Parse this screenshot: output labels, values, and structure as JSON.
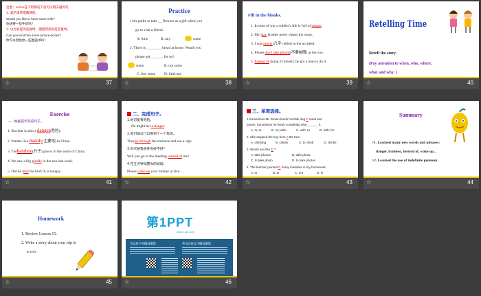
{
  "slides": [
    {
      "num": "37",
      "lines": [
        "注意：some在下列情况下也可以用于疑问句",
        "1. 表示请求或邀请时。",
        "Would you like to have some milk?",
        "你想要一些牛奶吗？",
        "2. 以为肯定的答复时，期望得到肯定答复时。",
        "Can you lend him some picture-books?",
        "你可以借给他一些图画书吗？"
      ]
    },
    {
      "num": "38",
      "title": "Practice",
      "lines": [
        "1.It's polite to take __ flowers as a gift when you",
        "go to visit a friend.",
        "A. little",
        "B. any",
        "some",
        "2. There is ________ bread at home. Would you",
        "please get_______ for us?",
        "some",
        "B. not  some",
        "C. few   some",
        "D. little   any"
      ]
    },
    {
      "num": "39",
      "title": "Fill in the blanks.",
      "lines": [
        "1. In time of war a soldier's life is full of",
        "danger",
        ".",
        "2. My l",
        "azy",
        "brother never cleans his room.",
        "3. I was",
        "nearly",
        "(几乎) killed in the accident.",
        "4. Please",
        "don't take photos",
        "(不要拍照) at the zoo.",
        "5.",
        "Instead of",
        "doing it himself, he got a man to do it."
      ]
    },
    {
      "num": "40",
      "title": "Retelling Time",
      "lines": [
        "Retell the story.",
        "(Pay attention to when, who, where,",
        "what and why. )"
      ]
    },
    {
      "num": "41",
      "title": "Exercise",
      "lines": [
        "一、根据提示完成句子。",
        "1. But fear is also a",
        "danger",
        "(危险).",
        "2. Pandas live",
        "mainly",
        "(主要地) in China.",
        "3. The",
        "bamboo",
        "(竹子) grows in the south of China.",
        "4. We saw a big g",
        "iraffe",
        "in the zoo last week.",
        "5. Did he f",
        "eed",
        "the bird? It is hungry."
      ]
    },
    {
      "num": "42",
      "title": "二、完成句子。",
      "lines": [
        "1.他可能有危险。",
        "He might be",
        "in danger",
        ".",
        "2.他们穿过门口看到了一个标志。",
        "They",
        "go through",
        "the entrance and see a sign.",
        "3.你代替我去开会好不好？",
        "Will you go to the meeting",
        "instead of",
        "me?",
        "4.在五点钟叫醒你的妈妈。",
        "Please",
        "wake up",
        "your mother at five."
      ]
    },
    {
      "num": "43",
      "title": "三、单项选择。",
      "lines": [
        "1.Sometimes Mr. Brown feeds his little  dog",
        "C",
        "meat and",
        "bones. Sometimes he feeds something  else ______ it.",
        "A. to; to",
        "B. on; with",
        "C. with; to",
        "D. with; for",
        "2. She stopped  the boy from",
        "A",
        "the tree.",
        "A. climbing",
        "B. climbs",
        "C. to climb",
        "D. climbs",
        "3. Would you like",
        "D",
        "?",
        "A. take photos",
        "B. take photo",
        "C. to take photo",
        "D. to take photos",
        "4. The teacher pointed",
        "C",
        "many mistakes in my homework.",
        "A. to",
        "B. at",
        "C. out",
        "D. in"
      ]
    },
    {
      "num": "44",
      "title": "Summary",
      "lines": [
        "1. Learned many new words and phrases:",
        "danger, bamboo, instead of, wake up...",
        "2. Learned the use of indefinite pronoun."
      ]
    },
    {
      "num": "45",
      "title": "Homework",
      "lines": [
        "1. Review  Lesson 15.",
        "2. Write a story about your trip to",
        "a zoo."
      ]
    },
    {
      "num": "46",
      "title": "第1PPT",
      "lines": [
        "www.1ppt.com",
        "可以在下列情况使用",
        "不可以在以下情况使用"
      ]
    }
  ]
}
